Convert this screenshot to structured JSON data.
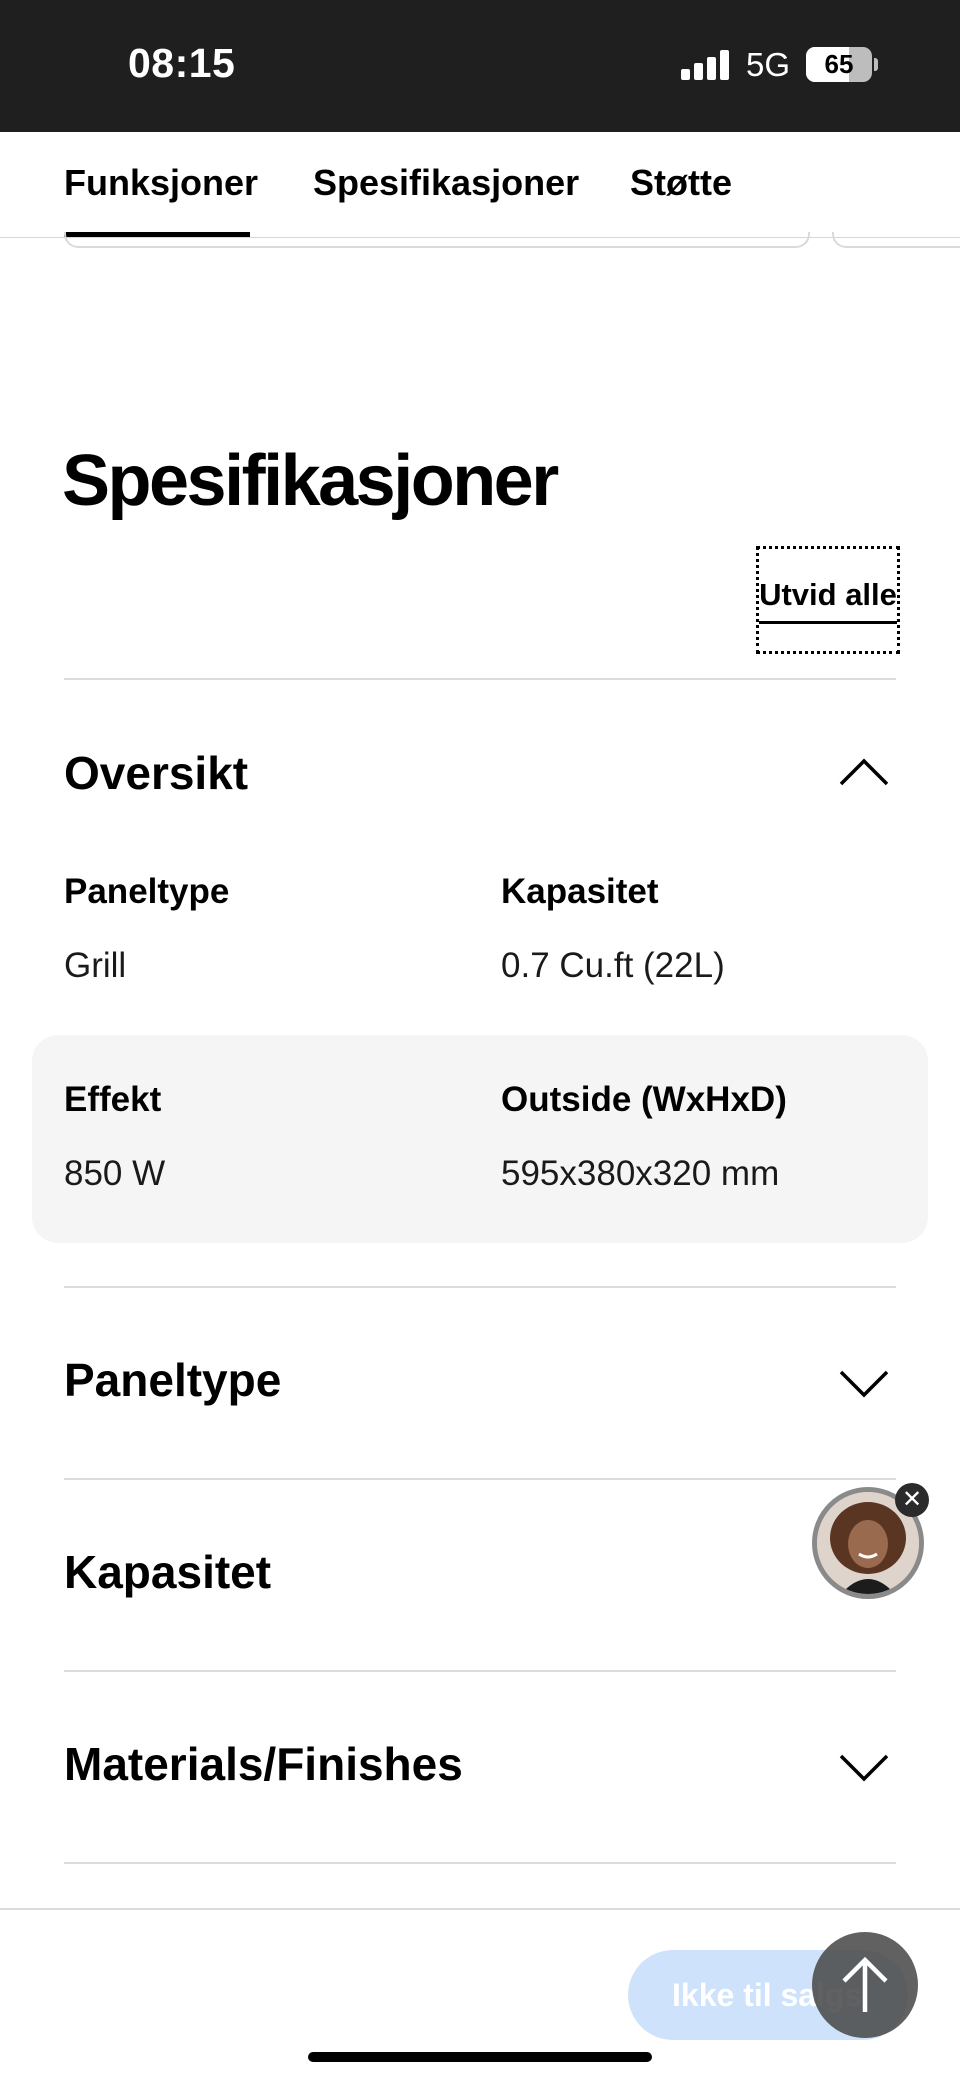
{
  "status_bar": {
    "time": "08:15",
    "network": "5G",
    "battery": "65",
    "battery_level": 0.65
  },
  "tabs": [
    {
      "label": "Funksjoner",
      "active": true
    },
    {
      "label": "Spesifikasjoner",
      "active": false
    },
    {
      "label": "Støtte",
      "active": false
    }
  ],
  "specs": {
    "heading": "Spesifikasjoner",
    "expand_all": "Utvid alle",
    "overview": {
      "title": "Oversikt",
      "icon": "chevron-up-icon",
      "items": [
        {
          "label": "Paneltype",
          "value": "Grill"
        },
        {
          "label": "Kapasitet",
          "value": "0.7 Cu.ft (22L)"
        },
        {
          "label": "Effekt",
          "value": "850 W"
        },
        {
          "label": "Outside (WxHxD)",
          "value": "595x380x320 mm"
        }
      ]
    },
    "sections": [
      {
        "title": "Paneltype",
        "icon": "chevron-down-icon"
      },
      {
        "title": "Kapasitet",
        "icon": "chevron-down-icon"
      },
      {
        "title": "Materials/Finishes",
        "icon": "chevron-down-icon"
      }
    ]
  },
  "chat": {
    "close": "✕"
  },
  "bottom": {
    "cta_label": "Ikke til salgs",
    "cta_color": "#cfe2fb"
  },
  "colors": {
    "status_bar": "#1f1f1f",
    "highlight": "#f5f5f5"
  }
}
